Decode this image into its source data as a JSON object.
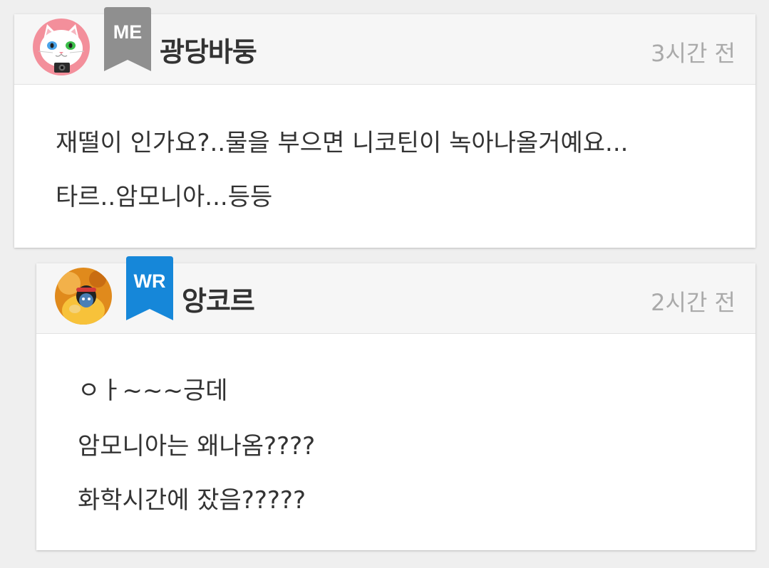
{
  "comments": [
    {
      "author": "광당바둥",
      "badge": "ME",
      "badge_color": "#8f8f8f",
      "time": "3시간 전",
      "avatar_icon": "white-cat-avatar-icon",
      "lines": [
        "재떨이 인가요?..물을 부으면 니코틴이 녹아나올거예요...",
        "타르..암모니아...등등"
      ]
    },
    {
      "author": "앙코르",
      "badge": "WR",
      "badge_color": "#1687d9",
      "time": "2시간 전",
      "avatar_icon": "cartoon-character-avatar-icon",
      "lines": [
        "ㅇㅏ~~~긍데",
        "암모니아는 왜나옴????",
        "화학시간에 잤음?????"
      ]
    }
  ]
}
